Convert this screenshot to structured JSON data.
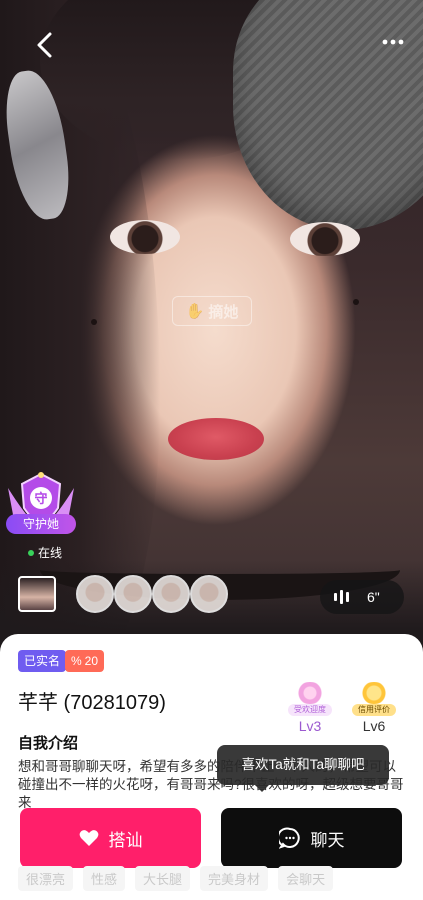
{
  "watermark": "摘她",
  "guard": {
    "label": "守护她"
  },
  "status": {
    "online": "在线"
  },
  "audio": {
    "duration": "6\""
  },
  "profile": {
    "verified_tag": "已实名",
    "match_percent": "20",
    "name": "芊芊 (70281079)",
    "levels": [
      {
        "caption": "受欢迎度",
        "value": "Lv3",
        "color": "#9b59d0"
      },
      {
        "caption": "信用评价",
        "value": "Lv6",
        "color": "#333333"
      }
    ],
    "intro_title": "自我介绍",
    "intro_text": "想和哥哥聊聊天呀，希望有多多的陪伴不止一个人的，希望可以碰撞出不一样的火花呀，有哥哥来吗?很喜欢的呀，超级想要哥哥来"
  },
  "tooltip": "喜欢Ta就和Ta聊聊吧",
  "actions": {
    "greet": "搭讪",
    "chat": "聊天"
  },
  "tags": [
    "很漂亮",
    "性感",
    "大长腿",
    "完美身材",
    "会聊天"
  ],
  "colors": {
    "greet": "#ff1f6a",
    "chat": "#0d0d0d",
    "verified": "#6f5cf0",
    "match": "#ff6a57"
  }
}
